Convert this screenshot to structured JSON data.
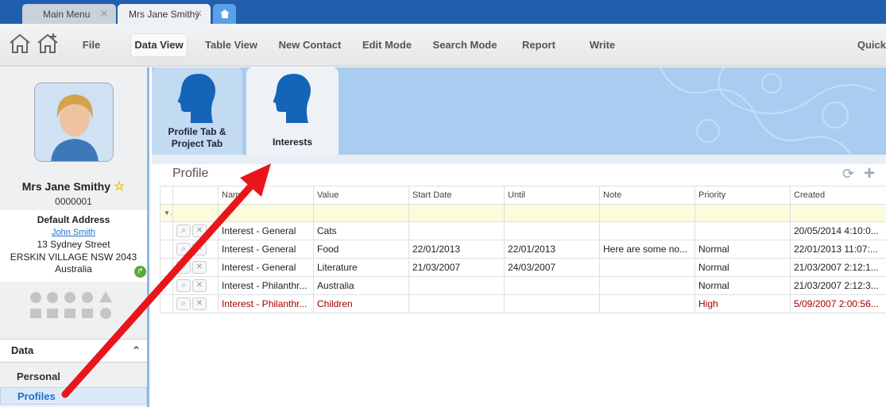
{
  "tabs": [
    {
      "label": "Main Menu"
    },
    {
      "label": "Mrs Jane Smithy"
    }
  ],
  "menu": {
    "file": "File",
    "data_view": "Data View",
    "table_view": "Table View",
    "new_contact": "New Contact",
    "edit_mode": "Edit Mode",
    "search_mode": "Search Mode",
    "report": "Report",
    "write": "Write",
    "quick": "Quick"
  },
  "contact": {
    "name": "Mrs Jane Smithy",
    "id": "0000001",
    "address_title": "Default Address",
    "address_name": "John Smith",
    "address_line1": "13 Sydney Street",
    "address_line2": "ERSKIN VILLAGE NSW 2043",
    "address_line3": "Australia"
  },
  "sidebar": {
    "section_title": "Data",
    "items": [
      {
        "label": "Personal"
      },
      {
        "label": "Profiles"
      }
    ]
  },
  "profile_tabs": [
    {
      "label_line1": "Profile Tab &",
      "label_line2": "Project Tab"
    },
    {
      "label_line1": "Interests"
    }
  ],
  "panel": {
    "title": "Profile"
  },
  "grid": {
    "columns": [
      "Name",
      "Value",
      "Start Date",
      "Until",
      "Note",
      "Priority",
      "Created"
    ],
    "rows": [
      {
        "name": "Interest - General",
        "value": "Cats",
        "start": "",
        "until": "",
        "note": "",
        "priority": "",
        "created": "20/05/2014 4:10:0..."
      },
      {
        "name": "Interest - General",
        "value": "Food",
        "start": "22/01/2013",
        "until": "22/01/2013",
        "note": "Here are some no...",
        "priority": "Normal",
        "created": "22/01/2013 11:07:..."
      },
      {
        "name": "Interest - General",
        "value": "Literature",
        "start": "21/03/2007",
        "until": "24/03/2007",
        "note": "",
        "priority": "Normal",
        "created": "21/03/2007 2:12:1..."
      },
      {
        "name": "Interest - Philanthr...",
        "value": "Australia",
        "start": "",
        "until": "",
        "note": "",
        "priority": "Normal",
        "created": "21/03/2007 2:12:3..."
      },
      {
        "name": "Interest - Philanthr...",
        "value": "Children",
        "start": "",
        "until": "",
        "note": "",
        "priority": "High",
        "created": "5/09/2007 2:00:56..."
      }
    ]
  },
  "colors": {
    "title_bar": "#1f5fae",
    "banner": "#a9cdf0",
    "link": "#1f6ed4",
    "high_priority_text": "#a40000",
    "annotation_arrow": "#e8161b"
  },
  "icons": [
    "home-icon",
    "home-add-icon",
    "close-icon",
    "star-icon",
    "refresh-icon",
    "add-icon",
    "search-icon",
    "delete-icon",
    "filter-icon",
    "chevron-up-icon",
    "person-head-icon",
    "go-arrow-icon"
  ]
}
